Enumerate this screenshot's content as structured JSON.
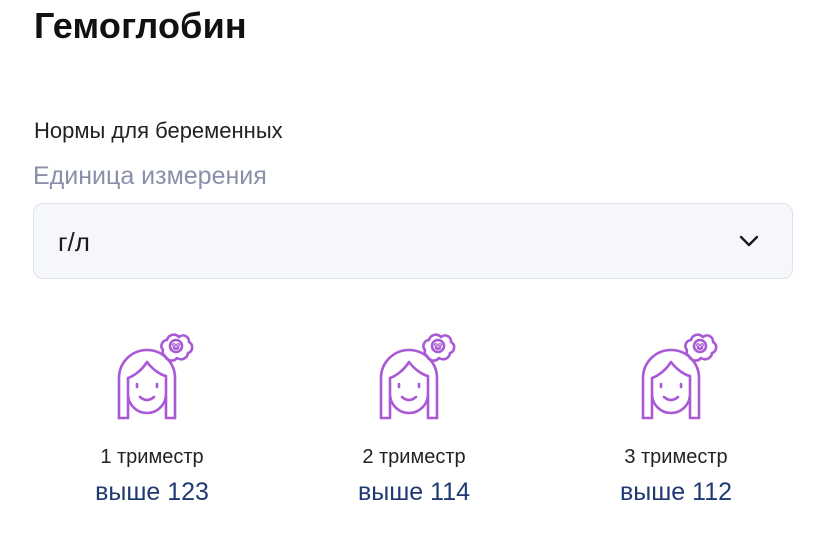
{
  "header": {
    "title": "Гемоглобин"
  },
  "norms": {
    "subtitle": "Нормы для беременных",
    "unit_label": "Единица измерения",
    "unit_select": {
      "value": "г/л",
      "icon": "chevron-down-icon"
    }
  },
  "trimesters": [
    {
      "label": "1 триместр",
      "value": "выше 123",
      "icon": "pregnant-woman-icon"
    },
    {
      "label": "2 триместр",
      "value": "выше 114",
      "icon": "pregnant-woman-icon"
    },
    {
      "label": "3 триместр",
      "value": "выше 112",
      "icon": "pregnant-woman-icon"
    }
  ],
  "colors": {
    "icon_stroke": "#a958d6",
    "value_text": "#1f3a73",
    "muted_label": "#8a90a8",
    "select_bg": "#f6f7fb",
    "select_border": "#dfe3ec"
  }
}
